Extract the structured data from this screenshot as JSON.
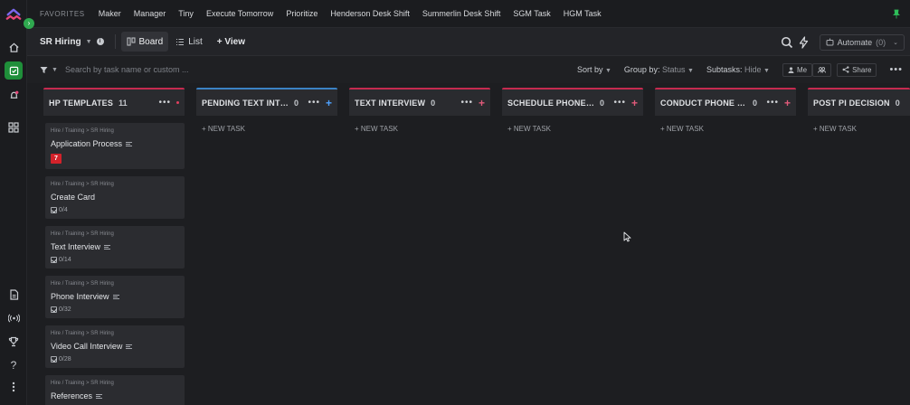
{
  "favorites": {
    "label": "FAVORITES",
    "items": [
      "Maker",
      "Manager",
      "Tiny",
      "Execute Tomorrow",
      "Prioritize",
      "Henderson Desk Shift",
      "Summerlin Desk Shift",
      "SGM Task",
      "HGM Task"
    ]
  },
  "header": {
    "space_name": "SR Hiring",
    "tabs": [
      {
        "label": "Board",
        "icon": "board-icon"
      },
      {
        "label": "List",
        "icon": "list-icon"
      }
    ],
    "add_view": "+ View",
    "automate_label": "Automate",
    "automate_count": "(0)"
  },
  "toolbar": {
    "search_placeholder": "Search by task name or custom ...",
    "sort_label": "Sort by",
    "group_label": "Group by:",
    "group_value": "Status",
    "subtasks_label": "Subtasks:",
    "subtasks_value": "Hide",
    "me_label": "Me",
    "share_label": "Share"
  },
  "board": {
    "new_task_label": "+ NEW TASK",
    "columns": [
      {
        "title": "HP TEMPLATES",
        "count": "11"
      },
      {
        "title": "PENDING TEXT INTE...",
        "count": "0"
      },
      {
        "title": "TEXT INTERVIEW",
        "count": "0"
      },
      {
        "title": "SCHEDULE PHONE IN...",
        "count": "0"
      },
      {
        "title": "CONDUCT PHONE IN...",
        "count": "0"
      },
      {
        "title": "POST PI DECISION",
        "count": "0"
      }
    ],
    "cards": [
      {
        "path": "Hire / Training > SR Hiring",
        "title": "Application Process",
        "badge": "7"
      },
      {
        "path": "Hire / Training > SR Hiring",
        "title": "Create Card",
        "checklist": "0/4"
      },
      {
        "path": "Hire / Training > SR Hiring",
        "title": "Text Interview",
        "checklist": "0/14"
      },
      {
        "path": "Hire / Training > SR Hiring",
        "title": "Phone Interview",
        "checklist": "0/32"
      },
      {
        "path": "Hire / Training > SR Hiring",
        "title": "Video Call Interview",
        "checklist": "0/28"
      },
      {
        "path": "Hire / Training > SR Hiring",
        "title": "References"
      }
    ]
  },
  "colors": {
    "accent_green": "#1f8f3a",
    "column_border": "#c62a4f",
    "badge_red": "#d3222a"
  }
}
